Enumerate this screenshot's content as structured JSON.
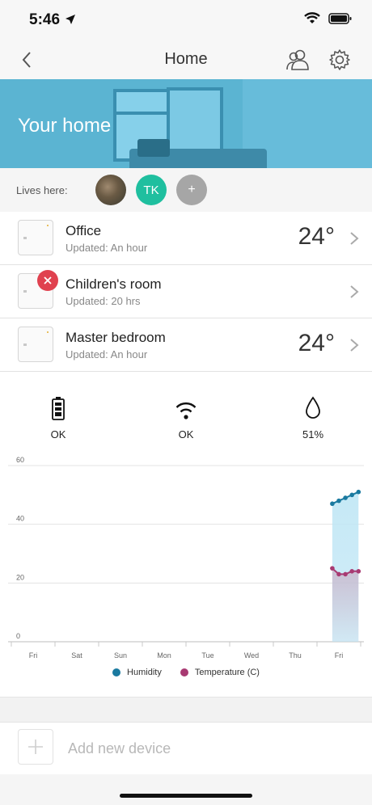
{
  "status": {
    "time": "5:46"
  },
  "nav": {
    "title": "Home"
  },
  "hero": {
    "title": "Your home"
  },
  "lives": {
    "label": "Lives here:",
    "members": [
      "TK",
      "+"
    ]
  },
  "rooms": [
    {
      "name": "Office",
      "updated": "Updated: An hour",
      "temp": "24°",
      "alert": false
    },
    {
      "name": "Children's room",
      "updated": "Updated: 20 hrs",
      "temp": "",
      "alert": true
    },
    {
      "name": "Master bedroom",
      "updated": "Updated: An hour",
      "temp": "24°",
      "alert": false
    }
  ],
  "metrics": {
    "battery": {
      "icon": "battery-icon",
      "value": "OK"
    },
    "wifi": {
      "icon": "wifi-icon",
      "value": "OK"
    },
    "humidity": {
      "icon": "water-drop-icon",
      "value": "51%"
    }
  },
  "colors": {
    "humidity": "#1a7aa0",
    "temperature": "#a83a72",
    "hero": "#5bb4d2",
    "tk_avatar": "#1fbf9f"
  },
  "chart_data": {
    "type": "line",
    "categories": [
      "Fri",
      "Sat",
      "Sun",
      "Mon",
      "Tue",
      "Wed",
      "Thu",
      "Fri"
    ],
    "ylim": [
      0,
      60
    ],
    "yticks": [
      "0",
      "20",
      "40",
      "60"
    ],
    "series": [
      {
        "name": "Humidity",
        "color": "#1a7aa0",
        "x": [
          6.85,
          7.0,
          7.15,
          7.3,
          7.45
        ],
        "values": [
          47,
          48,
          49,
          50,
          51
        ]
      },
      {
        "name": "Temperature (C)",
        "color": "#a83a72",
        "x": [
          6.85,
          7.0,
          7.15,
          7.3,
          7.45
        ],
        "values": [
          25,
          23,
          23,
          24,
          24
        ]
      }
    ],
    "grid": true,
    "legend": "bottom"
  },
  "add_device": {
    "label": "Add new device"
  }
}
